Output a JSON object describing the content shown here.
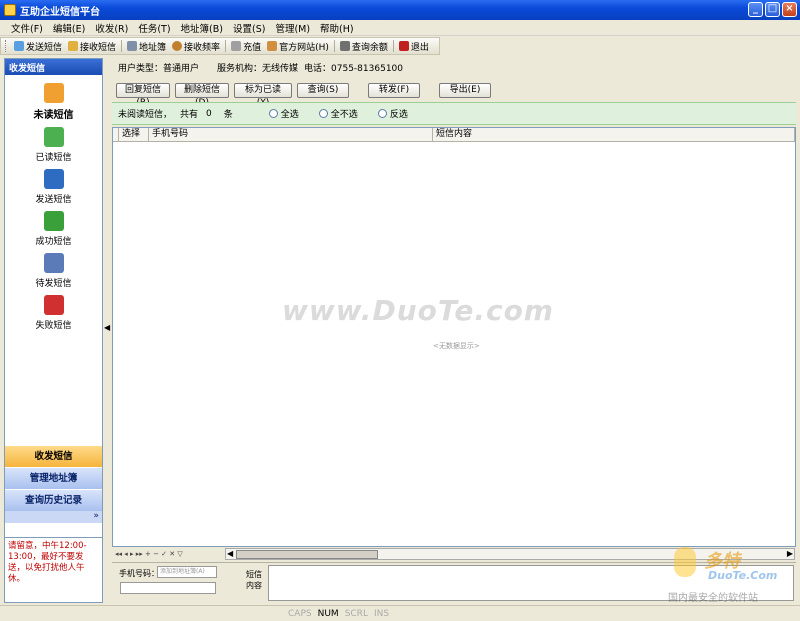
{
  "window": {
    "title": "互助企业短信平台"
  },
  "menu": [
    "文件(F)",
    "编辑(E)",
    "收发(R)",
    "任务(T)",
    "地址簿(B)",
    "设置(S)",
    "管理(M)",
    "帮助(H)"
  ],
  "toolbar": {
    "send_sms": "发送短信",
    "receive_sms": "接收短信",
    "address_book": "地址簿",
    "receive_freq": "接收频率",
    "recharge": "充值",
    "official_site": "官方网站(H)",
    "check_balance": "查询余额",
    "exit": "退出"
  },
  "sidebar": {
    "header": "收发短信",
    "items": [
      {
        "label": "未读短信",
        "icon": "unread-sms-icon",
        "color": "#f0a030"
      },
      {
        "label": "已读短信",
        "icon": "read-sms-icon",
        "color": "#4caf50"
      },
      {
        "label": "发送短信",
        "icon": "send-sms-icon",
        "color": "#2d6cc0"
      },
      {
        "label": "成功短信",
        "icon": "success-sms-icon",
        "color": "#3aa03a"
      },
      {
        "label": "待发短信",
        "icon": "pending-sms-icon",
        "color": "#5b7ab8"
      },
      {
        "label": "失败短信",
        "icon": "failed-sms-icon",
        "color": "#d03030"
      }
    ],
    "nav": [
      "收发短信",
      "管理地址簿",
      "查询历史记录"
    ],
    "note": "请留意，中午12:00-13:00，最好不要发送，以免打扰他人午休。"
  },
  "info": {
    "user_type": "用户类型：普通用户",
    "org": "服务机构：无线传媒",
    "phone": "电话：0755-81365100"
  },
  "actions": [
    "回复短信(R)",
    "删除短信(D)",
    "标为已读(Y)",
    "查询(S)",
    "转发(F)",
    "导出(E)"
  ],
  "filter": {
    "label": "未阅读短信，",
    "total_label": "共有",
    "count": "0",
    "unit": "条",
    "options": [
      "全选",
      "全不选",
      "反选"
    ]
  },
  "grid": {
    "columns": [
      "选择",
      "手机号码",
      "短信内容"
    ],
    "empty_text": "<无数据显示>"
  },
  "watermark": "www.DuoTe.com",
  "compose": {
    "phone_label": "手机号码：",
    "phone_placeholder": "添加到地址簿(A)",
    "content_label": "短信内容"
  },
  "status": [
    "CAPS",
    "NUM",
    "SCRL",
    "INS"
  ],
  "logo": {
    "main": "多特",
    "sub": "DuoTe.Com",
    "tag": "国内最安全的软件站"
  }
}
